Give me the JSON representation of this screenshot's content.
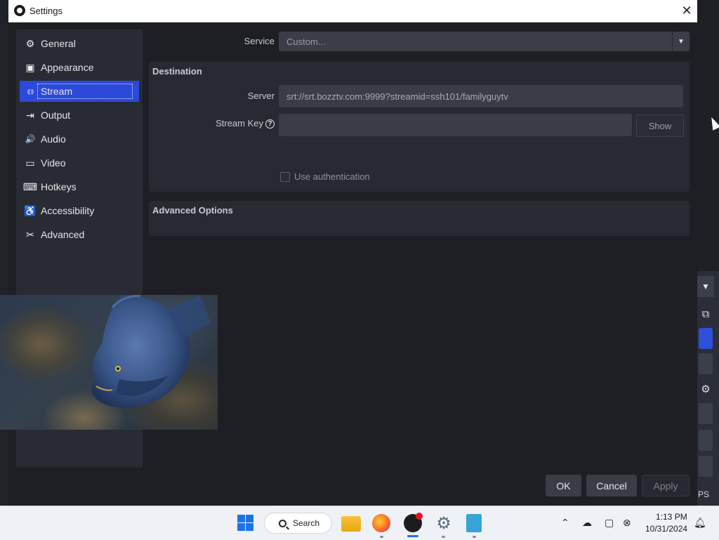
{
  "window": {
    "title": "Settings",
    "close_glyph": "✕"
  },
  "sidebar": {
    "items": [
      {
        "label": "General",
        "icon": "gear-icon",
        "glyph": "⚙"
      },
      {
        "label": "Appearance",
        "icon": "appearance-icon",
        "glyph": "▣"
      },
      {
        "label": "Stream",
        "icon": "broadcast-icon",
        "glyph": "((·))"
      },
      {
        "label": "Output",
        "icon": "output-icon",
        "glyph": "⇥"
      },
      {
        "label": "Audio",
        "icon": "speaker-icon",
        "glyph": "🔊"
      },
      {
        "label": "Video",
        "icon": "monitor-icon",
        "glyph": "▭"
      },
      {
        "label": "Hotkeys",
        "icon": "keyboard-icon",
        "glyph": "⌨"
      },
      {
        "label": "Accessibility",
        "icon": "accessibility-icon",
        "glyph": "♿"
      },
      {
        "label": "Advanced",
        "icon": "wrench-icon",
        "glyph": "✂"
      }
    ],
    "active_index": 2
  },
  "stream": {
    "service_label": "Service",
    "service_value": "Custom...",
    "destination_title": "Destination",
    "server_label": "Server",
    "server_value": "srt://srt.bozztv.com:9999?streamid=ssh101/familyguytv",
    "stream_key_label": "Stream Key",
    "stream_key_value": "",
    "show_button": "Show",
    "use_auth_label": "Use authentication",
    "use_auth_checked": false,
    "advanced_title": "Advanced Options"
  },
  "buttons": {
    "ok": "OK",
    "cancel": "Cancel",
    "apply": "Apply"
  },
  "background_app": {
    "fps_fragment": "PS"
  },
  "taskbar": {
    "search_label": "Search",
    "time": "1:13 PM",
    "date": "10/31/2024"
  },
  "colors": {
    "accent": "#2c4ad9",
    "window_bg": "#1d1f25",
    "sidebar_bg": "#282b33",
    "field_bg": "#3a3d46"
  }
}
